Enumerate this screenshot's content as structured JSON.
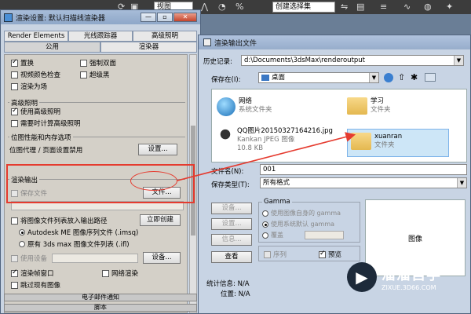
{
  "topbar": {
    "view_combo": "视图",
    "sel_combo": "创建选择集"
  },
  "render_setup": {
    "title": "渲染设置: 默认扫描线渲染器",
    "win_buttons": {
      "min": "—",
      "restore": "▫",
      "close": "✕"
    },
    "tabs_row1": [
      "Render Elements",
      "光线跟踪器",
      "高级照明"
    ],
    "tabs_row2": [
      "公用",
      "渲染器"
    ],
    "opts_row1": [
      "置换",
      "强制双面"
    ],
    "opts_row2": [
      "视频颜色检查",
      "超级黑"
    ],
    "opt_render_field": "渲染为场",
    "adv_lighting": {
      "title": "高级照明",
      "use": "使用高级照明",
      "compute": "需要时计算高级照明"
    },
    "bitmap": {
      "title": "位图性能和内存选项",
      "label": "位图代理 / 页面设置禁用",
      "setup_btn": "设置..."
    },
    "render_output": {
      "title": "渲染输出",
      "save_file": "保存文件",
      "file_btn": "文件..."
    },
    "img_seq": {
      "put_list": "将图像文件列表放入输出路径",
      "create_now": "立即创建",
      "autodesk": "Autodesk ME 图像序列文件 (.imsq)",
      "legacy": "原有 3ds max 图像文件列表 (.ifl)",
      "use_device": "使用设备",
      "device_btn": "设备..."
    },
    "frame_win": "渲染帧窗口",
    "net_render": "网络渲染",
    "skip_images": "跳过现有图像",
    "bottom1": "电子邮件通知",
    "bottom2": "脚本"
  },
  "file_dialog": {
    "title": "渲染输出文件",
    "history_label": "历史记录:",
    "history_value": "d:\\Documents\\3dsMax\\renderoutput",
    "save_in_label": "保存在(I):",
    "save_in_value": "桌面",
    "nav_icons": [
      "back-icon",
      "up-folder-icon",
      "new-folder-icon",
      "view-menu-icon"
    ],
    "items": [
      {
        "name": "网络",
        "sub": "系统文件夹",
        "icon": "network-icon"
      },
      {
        "name": "学习",
        "sub": "文件夹",
        "icon": "folder-icon"
      },
      {
        "name": "QQ图片20150327164216.jpg",
        "sub": "Kankan JPEG 图像",
        "sub2": "10.8 KB",
        "icon": "image-file-icon"
      },
      {
        "name": "xuanran",
        "sub": "文件夹",
        "icon": "folder-icon"
      }
    ],
    "filename_label": "文件名(N):",
    "filename_value": "001",
    "type_label": "保存类型(T):",
    "type_value": "所有格式",
    "side_buttons": [
      "设备...",
      "设置...",
      "信息...",
      "查看"
    ],
    "gamma": {
      "title": "Gamma",
      "own": "使用图像自身的 gamma",
      "system": "使用系统默认 gamma",
      "override": "覆盖"
    },
    "sequence": "序列",
    "preview_chk": "预览",
    "preview_label": "图像",
    "stats_label": "统计信息:",
    "stats_value": "N/A",
    "location_label": "位置:",
    "location_value": "N/A"
  },
  "watermark": {
    "main": "溜溜自学",
    "sub": "ZIXUE.3D66.COM"
  },
  "colors": {
    "highlight": "#e53b2f"
  }
}
